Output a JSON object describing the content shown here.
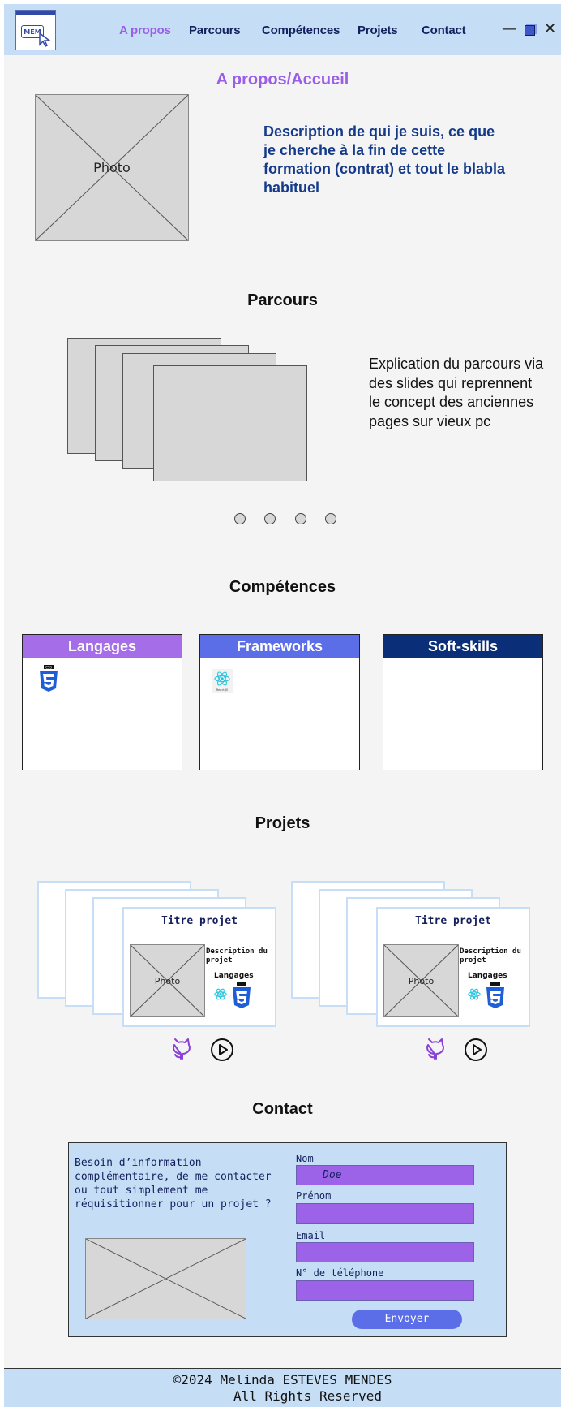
{
  "header": {
    "logo_text": "MEM",
    "nav": [
      "A propos",
      "Parcours",
      "Compétences",
      "Projets",
      "Contact"
    ],
    "active_nav": "A propos",
    "window_controls": {
      "minimize": "—",
      "close": "✕"
    }
  },
  "about": {
    "title": "A propos/Accueil",
    "photo_label": "Photo",
    "description": "Description de qui je suis, ce que je cherche à la fin de cette formation (contrat) et tout le blabla habituel"
  },
  "parcours": {
    "title": "Parcours",
    "explanation": "Explication du parcours via des slides qui reprennent le concept des anciennes pages sur vieux pc",
    "dots_count": 4
  },
  "competences": {
    "title": "Compétences",
    "cards": [
      {
        "label": "Langages",
        "color": "#a56ee8",
        "icon": "css3-icon"
      },
      {
        "label": "Frameworks",
        "color": "#5b6ee8",
        "icon": "react-icon"
      },
      {
        "label": "Soft-skills",
        "color": "#0a2f78"
      }
    ]
  },
  "projets": {
    "title": "Projets",
    "items": [
      {
        "title": "Titre projet",
        "description": "Description du projet",
        "photo_label": "Photo",
        "langs_label": "Langages"
      },
      {
        "title": "Titre projet",
        "description": "Description du projet",
        "photo_label": "Photo",
        "langs_label": "Langages"
      }
    ]
  },
  "contact": {
    "title": "Contact",
    "message": "Besoin d’information complémentaire, de me contacter ou tout simplement me réquisitionner pour un projet ?",
    "fields": {
      "nom": {
        "label": "Nom",
        "value": "Doe"
      },
      "prenom": {
        "label": "Prénom",
        "value": ""
      },
      "email": {
        "label": "Email",
        "value": ""
      },
      "telephone": {
        "label": "N° de téléphone",
        "value": ""
      }
    },
    "submit": "Envoyer"
  },
  "footer": {
    "line1": "©2024 Melinda ESTEVES MENDES",
    "line2": "All Rights Reserved"
  },
  "colors": {
    "header_bg": "#c5ddf5",
    "accent": "#9c63e8",
    "nav_text": "#14205e",
    "desc_text": "#153a8a"
  }
}
